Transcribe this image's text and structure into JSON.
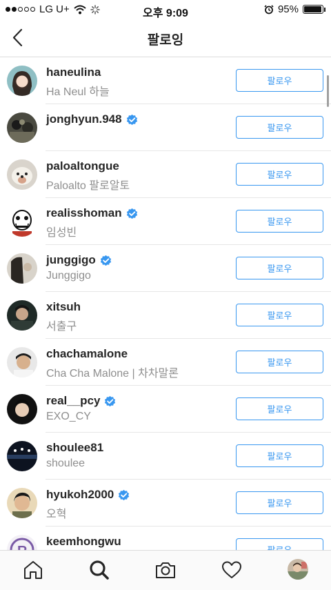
{
  "status_bar": {
    "carrier": "LG U+",
    "time": "오후 9:09",
    "battery_percent": "95%",
    "battery_level": 0.95
  },
  "header": {
    "title": "팔로잉",
    "back_icon": "chevron-left-icon"
  },
  "follow_label": "팔로우",
  "users": [
    {
      "username": "haneulina",
      "full_name": "Ha Neul 하늘",
      "verified": false
    },
    {
      "username": "jonghyun.948",
      "full_name": "",
      "verified": true
    },
    {
      "username": "paloaltongue",
      "full_name": "Paloalto 팔로알토",
      "verified": false
    },
    {
      "username": "realisshoman",
      "full_name": "임성빈",
      "verified": true
    },
    {
      "username": "junggigo",
      "full_name": "Junggigo",
      "verified": true
    },
    {
      "username": "xitsuh",
      "full_name": "서출구",
      "verified": false
    },
    {
      "username": "chachamalone",
      "full_name": "Cha Cha Malone | 차차말론",
      "verified": false
    },
    {
      "username": "real__pcy",
      "full_name": "EXO_CY",
      "verified": true
    },
    {
      "username": "shoulee81",
      "full_name": "shoulee",
      "verified": false
    },
    {
      "username": "hyukoh2000",
      "full_name": "오혁",
      "verified": true
    },
    {
      "username": "keemhongwu",
      "full_name": "",
      "verified": false
    }
  ],
  "tab_bar": {
    "tabs": [
      "home-icon",
      "search-icon",
      "camera-icon",
      "heart-icon",
      "profile-avatar"
    ],
    "active": "search-icon"
  },
  "colors": {
    "accent": "#3897f0",
    "verified": "#3897f0",
    "divider": "#e6e6e6"
  }
}
